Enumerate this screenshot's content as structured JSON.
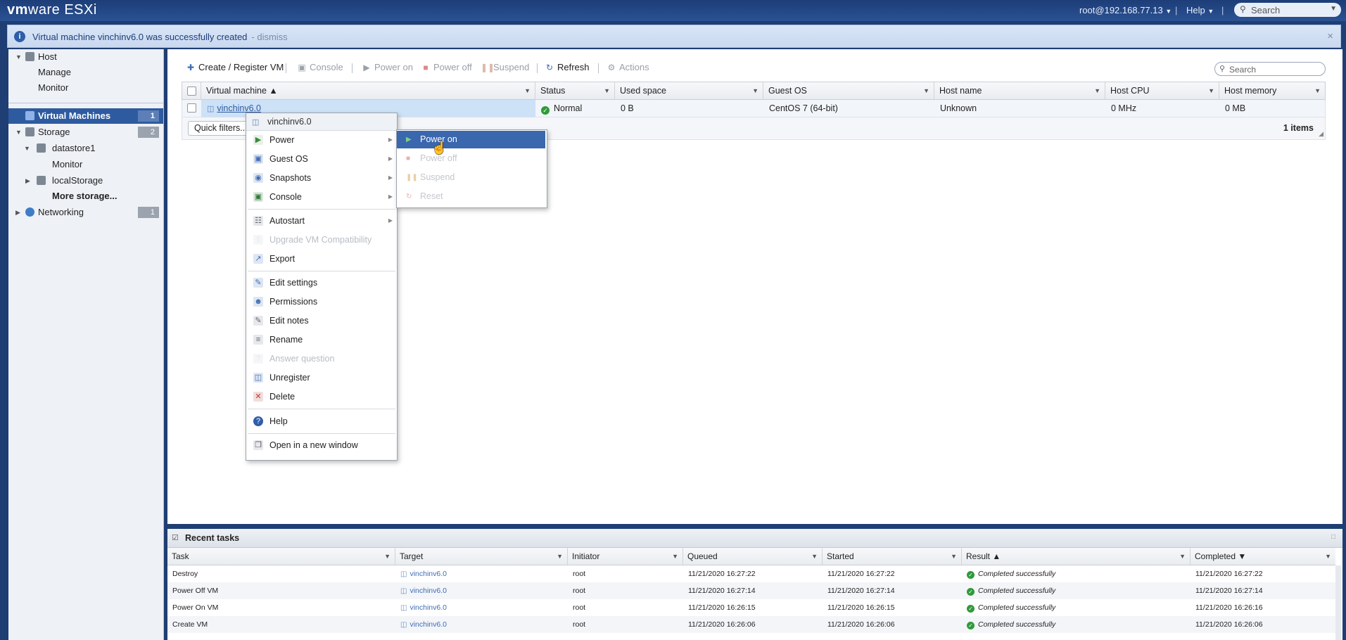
{
  "header": {
    "logo_brand": "vm",
    "logo_rest": "ware ESXi",
    "user": "root@192.168.77.13",
    "help": "Help",
    "search_placeholder": "Search"
  },
  "notification": {
    "message": "Virtual machine vinchinv6.0 was successfully created",
    "dismiss": "- dismiss",
    "close": "×"
  },
  "navigator": {
    "host": "Host",
    "manage": "Manage",
    "monitor": "Monitor",
    "virtual_machines": {
      "label": "Virtual Machines",
      "count": "1"
    },
    "storage": {
      "label": "Storage",
      "count": "2"
    },
    "datastore1": "datastore1",
    "datastore_monitor": "Monitor",
    "local_storage": "localStorage",
    "more_storage": "More storage...",
    "networking": {
      "label": "Networking",
      "count": "1"
    }
  },
  "toolbar": {
    "create": "Create / Register VM",
    "console": "Console",
    "power_on": "Power on",
    "power_off": "Power off",
    "suspend": "Suspend",
    "refresh": "Refresh",
    "actions": "Actions",
    "search_placeholder": "Search"
  },
  "vm_grid": {
    "columns": [
      "Virtual machine ▲",
      "Status",
      "Used space",
      "Guest OS",
      "Host name",
      "Host CPU",
      "Host memory"
    ],
    "row": {
      "name": "vinchinv6.0",
      "status": "Normal",
      "used_space": "0 B",
      "guest_os": "CentOS 7 (64-bit)",
      "host_name": "Unknown",
      "host_cpu": "0 MHz",
      "host_memory": "0 MB"
    },
    "quick_filters": "Quick filters...",
    "items": "1 items"
  },
  "context_menu": {
    "title": "vinchinv6.0",
    "items": [
      "Power",
      "Guest OS",
      "Snapshots",
      "Console",
      "Autostart",
      "Upgrade VM Compatibility",
      "Export",
      "Edit settings",
      "Permissions",
      "Edit notes",
      "Rename",
      "Answer question",
      "Unregister",
      "Delete",
      "Help",
      "Open in a new window"
    ]
  },
  "power_submenu": {
    "items": [
      "Power on",
      "Power off",
      "Suspend",
      "Reset"
    ]
  },
  "recent_tasks": {
    "title": "Recent tasks",
    "columns": [
      "Task",
      "Target",
      "Initiator",
      "Queued",
      "Started",
      "Result ▲",
      "Completed ▼"
    ],
    "rows": [
      {
        "task": "Destroy",
        "target": "vinchinv6.0",
        "initiator": "root",
        "queued": "11/21/2020 16:27:22",
        "started": "11/21/2020 16:27:22",
        "result": "Completed successfully",
        "completed": "11/21/2020 16:27:22"
      },
      {
        "task": "Power Off VM",
        "target": "vinchinv6.0",
        "initiator": "root",
        "queued": "11/21/2020 16:27:14",
        "started": "11/21/2020 16:27:14",
        "result": "Completed successfully",
        "completed": "11/21/2020 16:27:14"
      },
      {
        "task": "Power On VM",
        "target": "vinchinv6.0",
        "initiator": "root",
        "queued": "11/21/2020 16:26:15",
        "started": "11/21/2020 16:26:15",
        "result": "Completed successfully",
        "completed": "11/21/2020 16:26:16"
      },
      {
        "task": "Create VM",
        "target": "vinchinv6.0",
        "initiator": "root",
        "queued": "11/21/2020 16:26:06",
        "started": "11/21/2020 16:26:06",
        "result": "Completed successfully",
        "completed": "11/21/2020 16:26:06"
      }
    ]
  },
  "colors": {
    "header_blue": "#1d3d78",
    "selection_blue": "#2e5ba0",
    "success_green": "#2f9a3a"
  }
}
